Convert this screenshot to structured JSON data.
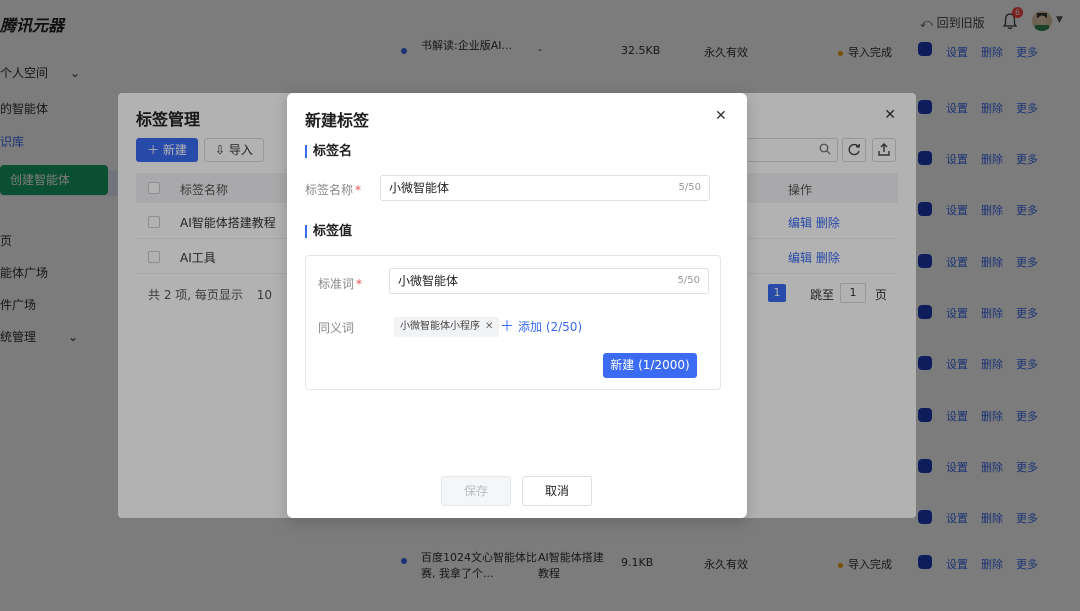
{
  "app": {
    "logo": "腾讯元器",
    "back_to_old": "回到旧版",
    "notification_count": "6"
  },
  "sidebar": {
    "items": [
      {
        "label": "个人空间"
      },
      {
        "label": "的智能体"
      },
      {
        "label": "识库"
      },
      {
        "label": "创建智能体"
      },
      {
        "label": "页"
      },
      {
        "label": "能体广场"
      },
      {
        "label": "件广场"
      },
      {
        "label": "统管理"
      }
    ]
  },
  "bg_table": {
    "rows": [
      {
        "name": "百度1024文心智能体比赛, 我拿了个...",
        "type": "AI智能体搭建教程",
        "size": "9.1KB",
        "validity": "永久有效",
        "status": "导入完成"
      },
      {
        "name": "书解读:企业版AI...",
        "type": "-",
        "size": "32.5KB",
        "validity": "永久有效",
        "status": "导入完成"
      }
    ],
    "actions": [
      "设置",
      "删除",
      "更多"
    ]
  },
  "tag_manager": {
    "title": "标签管理",
    "new_label": "新建",
    "import_label": "导入",
    "columns": [
      "标签名称",
      "操作"
    ],
    "rows": [
      {
        "name": "AI智能体搭建教程",
        "ops": "编辑 删除"
      },
      {
        "name": "AI工具",
        "ops": "编辑 删除"
      }
    ],
    "footer": "共 2 项, 每页显示",
    "page_size": "10",
    "current_page": "1",
    "jump_label": "跳至",
    "jump_value": "1",
    "page_unit": "页"
  },
  "new_tag": {
    "title": "新建标签",
    "section_name": "标签名",
    "name_label": "标签名称",
    "name_value": "小微智能体",
    "name_count": "5/50",
    "section_value": "标签值",
    "standard_label": "标准词",
    "standard_value": "小微智能体",
    "standard_count": "5/50",
    "synonym_label": "同义词",
    "synonym_chip": "小微智能体小程序",
    "add_label": "添加 (2/50)",
    "new_button": "新建 (1/2000)",
    "save_button": "保存",
    "cancel_button": "取消"
  },
  "colors": {
    "primary": "#3a6bf2",
    "required": "#e34d4d"
  }
}
